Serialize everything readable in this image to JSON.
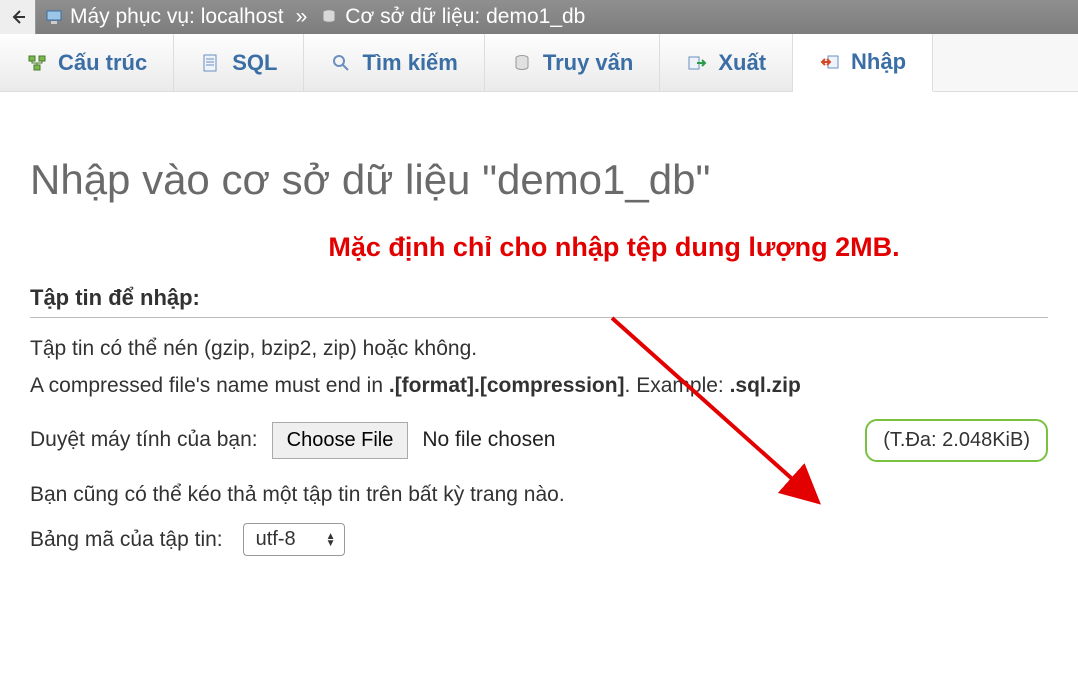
{
  "breadcrumb": {
    "server_label": "Máy phục vụ: localhost",
    "separator": "»",
    "database_label": "Cơ sở dữ liệu: demo1_db"
  },
  "tabs": [
    {
      "id": "structure",
      "label": "Cấu trúc",
      "icon": "structure-icon"
    },
    {
      "id": "sql",
      "label": "SQL",
      "icon": "sql-icon"
    },
    {
      "id": "search",
      "label": "Tìm kiếm",
      "icon": "search-icon"
    },
    {
      "id": "query",
      "label": "Truy vấn",
      "icon": "query-icon"
    },
    {
      "id": "export",
      "label": "Xuất",
      "icon": "export-icon"
    },
    {
      "id": "import",
      "label": "Nhập",
      "icon": "import-icon",
      "active": true
    }
  ],
  "page_title": "Nhập vào cơ sở dữ liệu \"demo1_db\"",
  "annotation": "Mặc định chỉ cho nhập tệp dung lượng 2MB.",
  "section": {
    "title": "Tập tin để nhập:",
    "line1": "Tập tin có thể nén (gzip, bzip2, zip) hoặc không.",
    "line2_prefix": "A compressed file's name must end in ",
    "line2_bold1": ".[format].[compression]",
    "line2_mid": ". Example: ",
    "line2_bold2": ".sql.zip",
    "browse_label": "Duyệt máy tính của bạn:",
    "choose_file": "Choose File",
    "no_file": "No file chosen",
    "max_label": "(T.Đa: 2.048KiB)",
    "dragdrop_hint": "Bạn cũng có thể kéo thả một tập tin trên bất kỳ trang nào.",
    "charset_label": "Bảng mã của tập tin:",
    "charset_value": "utf-8"
  }
}
